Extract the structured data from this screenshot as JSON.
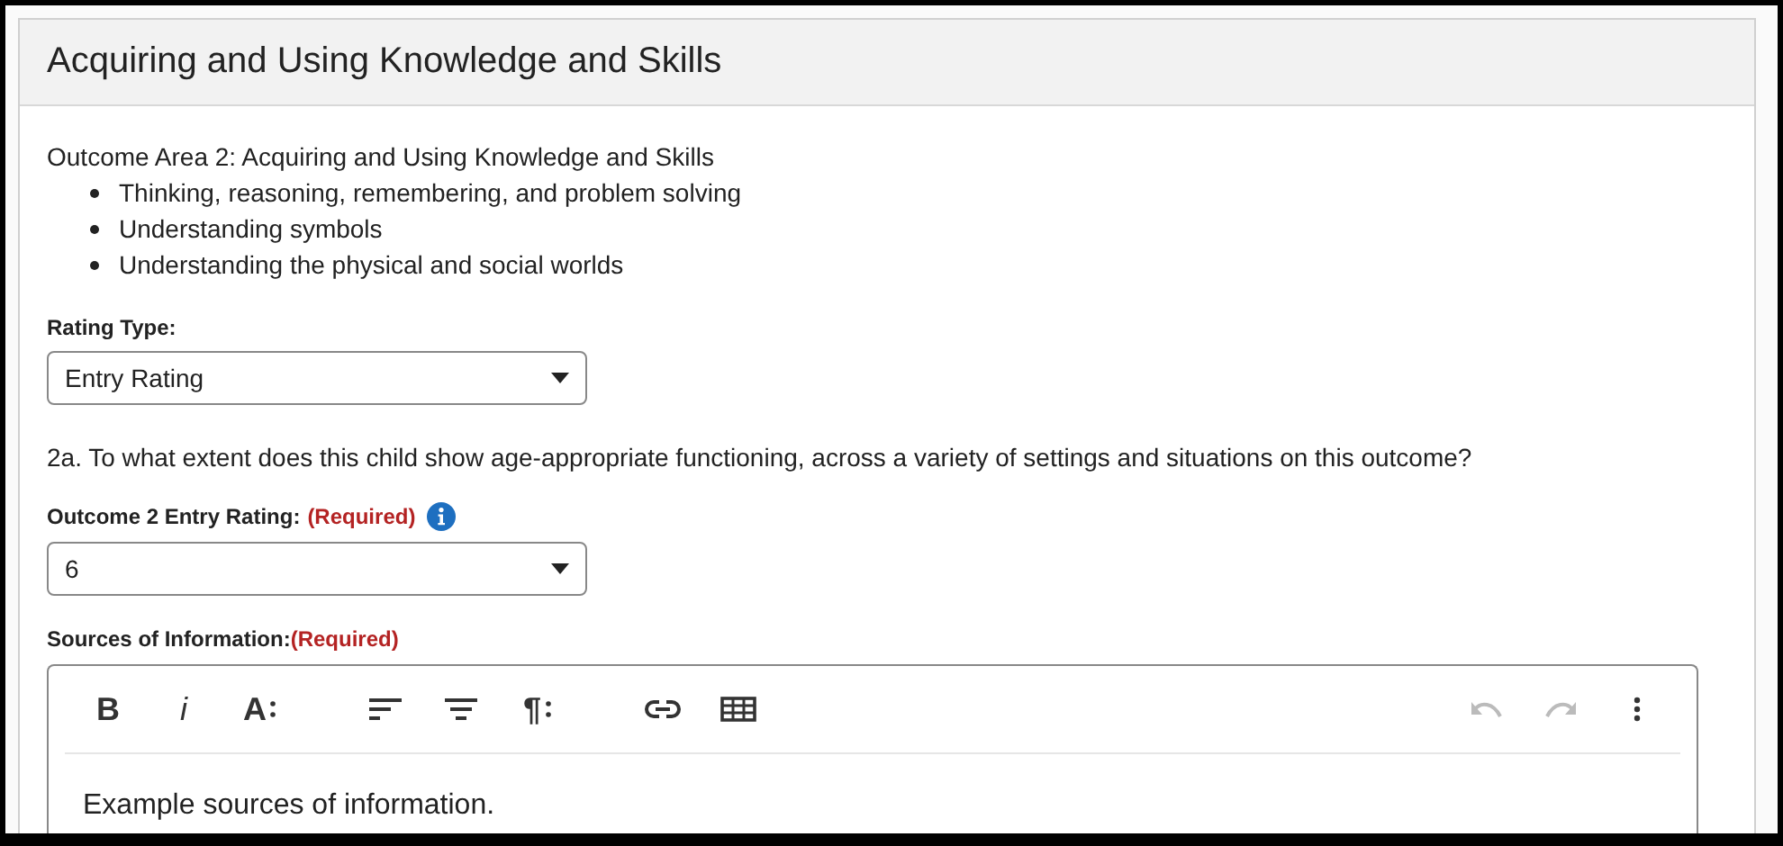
{
  "panel": {
    "title": "Acquiring and Using Knowledge and Skills"
  },
  "outcome": {
    "heading": "Outcome Area 2: Acquiring and Using Knowledge and Skills",
    "items": [
      "Thinking, reasoning, remembering, and problem solving",
      "Understanding symbols",
      "Understanding the physical and social worlds"
    ]
  },
  "rating_type": {
    "label": "Rating Type:",
    "value": "Entry Rating"
  },
  "question": "2a. To what extent does this child show age-appropriate functioning, across a variety of settings and situations on this outcome?",
  "entry_rating": {
    "label": "Outcome 2 Entry Rating:",
    "required": "(Required)",
    "info": true,
    "value": "6"
  },
  "sources": {
    "label": "Sources of Information:",
    "required": "(Required)",
    "text": "Example sources of information.",
    "toolbar": [
      [
        {
          "kind": "bold",
          "label": "B",
          "disabled": false
        },
        {
          "kind": "italic",
          "label": "i",
          "disabled": false
        },
        {
          "kind": "font-size",
          "label": "A",
          "disabled": false
        }
      ],
      [
        {
          "kind": "align-left",
          "disabled": false
        },
        {
          "kind": "align-center",
          "disabled": false
        },
        {
          "kind": "paragraph",
          "label": "¶",
          "disabled": false
        }
      ],
      [
        {
          "kind": "link",
          "disabled": false
        },
        {
          "kind": "table",
          "disabled": false
        }
      ],
      [
        {
          "kind": "spacer"
        }
      ],
      [
        {
          "kind": "undo",
          "disabled": true
        },
        {
          "kind": "redo",
          "disabled": true
        },
        {
          "kind": "more",
          "disabled": false
        }
      ]
    ]
  }
}
